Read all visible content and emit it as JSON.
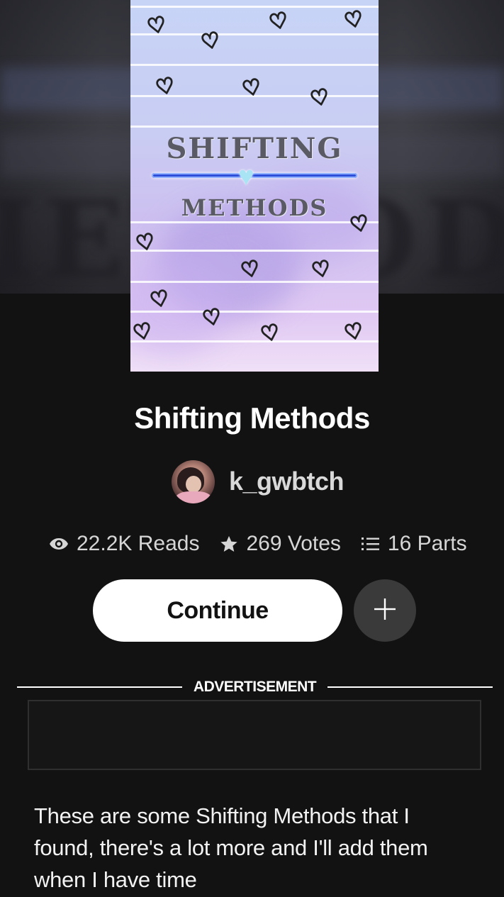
{
  "story": {
    "title": "Shifting Methods",
    "cover": {
      "line1": "SHIFTING",
      "line2": "METHODS",
      "heart_icon": "heart-outline-icon",
      "divider_heart_icon": "heart-icon"
    },
    "author": {
      "username": "k_gwbtch",
      "avatar_icon": "user-avatar"
    },
    "stats": {
      "reads": {
        "icon": "eye-icon",
        "label": "22.2K Reads"
      },
      "votes": {
        "icon": "star-icon",
        "label": "269 Votes"
      },
      "parts": {
        "icon": "list-icon",
        "label": "16 Parts"
      }
    },
    "actions": {
      "continue_label": "Continue",
      "add_icon": "plus-icon"
    },
    "advertisement": {
      "label": "ADVERTISEMENT"
    },
    "description": "These are some Shifting Methods that I found, there's a lot more and I'll add them when I have time"
  },
  "colors": {
    "background": "#121212",
    "button_primary": "#ffffff",
    "button_secondary": "#3a3a3a",
    "text_muted": "#d6d6d6"
  }
}
